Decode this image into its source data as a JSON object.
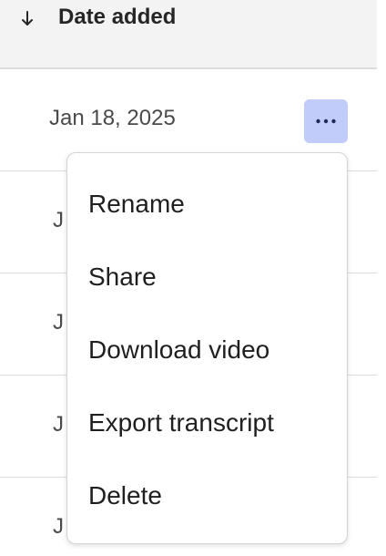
{
  "header": {
    "title": "Date added",
    "sort_icon": "arrow-down-icon"
  },
  "rows": [
    {
      "date": "Jan 18, 2025",
      "more_icon": "more-horizontal-icon"
    },
    {
      "date": "J"
    },
    {
      "date": "J"
    },
    {
      "date": "J"
    },
    {
      "date": "J"
    }
  ],
  "menu": {
    "items": [
      {
        "label": "Rename"
      },
      {
        "label": "Share"
      },
      {
        "label": "Download video"
      },
      {
        "label": "Export transcript"
      },
      {
        "label": "Delete"
      }
    ]
  },
  "colors": {
    "accent_button": "#c2ccfb",
    "header_background": "#f3f3f3",
    "divider": "#dcdcdc"
  }
}
